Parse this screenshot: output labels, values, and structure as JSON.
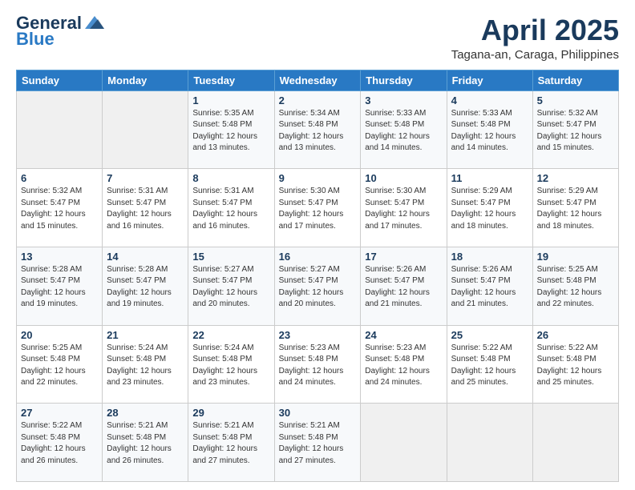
{
  "header": {
    "logo_general": "General",
    "logo_blue": "Blue",
    "month_title": "April 2025",
    "location": "Tagana-an, Caraga, Philippines"
  },
  "days_of_week": [
    "Sunday",
    "Monday",
    "Tuesday",
    "Wednesday",
    "Thursday",
    "Friday",
    "Saturday"
  ],
  "weeks": [
    [
      {
        "day": "",
        "info": ""
      },
      {
        "day": "",
        "info": ""
      },
      {
        "day": "1",
        "info": "Sunrise: 5:35 AM\nSunset: 5:48 PM\nDaylight: 12 hours and 13 minutes."
      },
      {
        "day": "2",
        "info": "Sunrise: 5:34 AM\nSunset: 5:48 PM\nDaylight: 12 hours and 13 minutes."
      },
      {
        "day": "3",
        "info": "Sunrise: 5:33 AM\nSunset: 5:48 PM\nDaylight: 12 hours and 14 minutes."
      },
      {
        "day": "4",
        "info": "Sunrise: 5:33 AM\nSunset: 5:48 PM\nDaylight: 12 hours and 14 minutes."
      },
      {
        "day": "5",
        "info": "Sunrise: 5:32 AM\nSunset: 5:47 PM\nDaylight: 12 hours and 15 minutes."
      }
    ],
    [
      {
        "day": "6",
        "info": "Sunrise: 5:32 AM\nSunset: 5:47 PM\nDaylight: 12 hours and 15 minutes."
      },
      {
        "day": "7",
        "info": "Sunrise: 5:31 AM\nSunset: 5:47 PM\nDaylight: 12 hours and 16 minutes."
      },
      {
        "day": "8",
        "info": "Sunrise: 5:31 AM\nSunset: 5:47 PM\nDaylight: 12 hours and 16 minutes."
      },
      {
        "day": "9",
        "info": "Sunrise: 5:30 AM\nSunset: 5:47 PM\nDaylight: 12 hours and 17 minutes."
      },
      {
        "day": "10",
        "info": "Sunrise: 5:30 AM\nSunset: 5:47 PM\nDaylight: 12 hours and 17 minutes."
      },
      {
        "day": "11",
        "info": "Sunrise: 5:29 AM\nSunset: 5:47 PM\nDaylight: 12 hours and 18 minutes."
      },
      {
        "day": "12",
        "info": "Sunrise: 5:29 AM\nSunset: 5:47 PM\nDaylight: 12 hours and 18 minutes."
      }
    ],
    [
      {
        "day": "13",
        "info": "Sunrise: 5:28 AM\nSunset: 5:47 PM\nDaylight: 12 hours and 19 minutes."
      },
      {
        "day": "14",
        "info": "Sunrise: 5:28 AM\nSunset: 5:47 PM\nDaylight: 12 hours and 19 minutes."
      },
      {
        "day": "15",
        "info": "Sunrise: 5:27 AM\nSunset: 5:47 PM\nDaylight: 12 hours and 20 minutes."
      },
      {
        "day": "16",
        "info": "Sunrise: 5:27 AM\nSunset: 5:47 PM\nDaylight: 12 hours and 20 minutes."
      },
      {
        "day": "17",
        "info": "Sunrise: 5:26 AM\nSunset: 5:47 PM\nDaylight: 12 hours and 21 minutes."
      },
      {
        "day": "18",
        "info": "Sunrise: 5:26 AM\nSunset: 5:47 PM\nDaylight: 12 hours and 21 minutes."
      },
      {
        "day": "19",
        "info": "Sunrise: 5:25 AM\nSunset: 5:48 PM\nDaylight: 12 hours and 22 minutes."
      }
    ],
    [
      {
        "day": "20",
        "info": "Sunrise: 5:25 AM\nSunset: 5:48 PM\nDaylight: 12 hours and 22 minutes."
      },
      {
        "day": "21",
        "info": "Sunrise: 5:24 AM\nSunset: 5:48 PM\nDaylight: 12 hours and 23 minutes."
      },
      {
        "day": "22",
        "info": "Sunrise: 5:24 AM\nSunset: 5:48 PM\nDaylight: 12 hours and 23 minutes."
      },
      {
        "day": "23",
        "info": "Sunrise: 5:23 AM\nSunset: 5:48 PM\nDaylight: 12 hours and 24 minutes."
      },
      {
        "day": "24",
        "info": "Sunrise: 5:23 AM\nSunset: 5:48 PM\nDaylight: 12 hours and 24 minutes."
      },
      {
        "day": "25",
        "info": "Sunrise: 5:22 AM\nSunset: 5:48 PM\nDaylight: 12 hours and 25 minutes."
      },
      {
        "day": "26",
        "info": "Sunrise: 5:22 AM\nSunset: 5:48 PM\nDaylight: 12 hours and 25 minutes."
      }
    ],
    [
      {
        "day": "27",
        "info": "Sunrise: 5:22 AM\nSunset: 5:48 PM\nDaylight: 12 hours and 26 minutes."
      },
      {
        "day": "28",
        "info": "Sunrise: 5:21 AM\nSunset: 5:48 PM\nDaylight: 12 hours and 26 minutes."
      },
      {
        "day": "29",
        "info": "Sunrise: 5:21 AM\nSunset: 5:48 PM\nDaylight: 12 hours and 27 minutes."
      },
      {
        "day": "30",
        "info": "Sunrise: 5:21 AM\nSunset: 5:48 PM\nDaylight: 12 hours and 27 minutes."
      },
      {
        "day": "",
        "info": ""
      },
      {
        "day": "",
        "info": ""
      },
      {
        "day": "",
        "info": ""
      }
    ]
  ]
}
